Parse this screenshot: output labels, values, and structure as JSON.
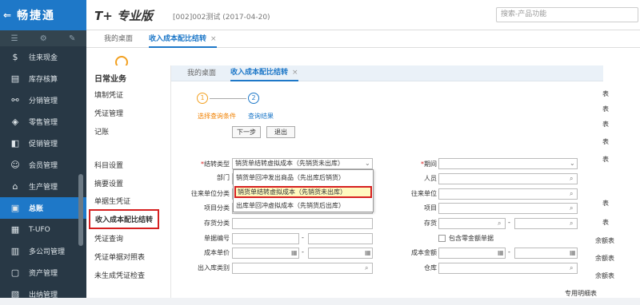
{
  "app": {
    "logo": "畅捷通",
    "brand": "T+ 专业版",
    "account": "[002]002测试  (2017-04-20)",
    "search_placeholder": "搜索-产品功能"
  },
  "sidebar": {
    "items": [
      {
        "label": "往来现金",
        "icon": "cash-icon"
      },
      {
        "label": "库存核算",
        "icon": "stock-icon"
      },
      {
        "label": "分销管理",
        "icon": "distribution-icon"
      },
      {
        "label": "零售管理",
        "icon": "retail-icon"
      },
      {
        "label": "促销管理",
        "icon": "promotion-icon"
      },
      {
        "label": "会员管理",
        "icon": "member-icon"
      },
      {
        "label": "生产管理",
        "icon": "production-icon"
      },
      {
        "label": "总账",
        "icon": "ledger-icon"
      },
      {
        "label": "T-UFO",
        "icon": "ufo-icon"
      },
      {
        "label": "多公司管理",
        "icon": "company-icon"
      },
      {
        "label": "资产管理",
        "icon": "asset-icon"
      },
      {
        "label": "出纳管理",
        "icon": "cashier-icon"
      }
    ]
  },
  "tabs": {
    "home": "我的桌面",
    "current": "收入成本配比结转"
  },
  "menu": {
    "title": "日常业务",
    "items": [
      "填制凭证",
      "凭证管理",
      "记账",
      "科目设置",
      "摘要设置",
      "单据生凭证",
      "收入成本配比结转",
      "凭证查询",
      "凭证单据对照表",
      "未生成凭证检查"
    ]
  },
  "wizard": {
    "step1_num": "1",
    "step2_num": "2",
    "step1_label": "选择查询条件",
    "step2_label": "查询结果",
    "next_button": "下一步",
    "exit_button": "退出"
  },
  "form": {
    "left_labels": [
      "结转类型",
      "部门",
      "往来单位分类",
      "项目分类",
      "存货分类",
      "单据编号",
      "成本单价",
      "出入库类别"
    ],
    "right_labels": [
      "期间",
      "人员",
      "往来单位",
      "项目",
      "存货",
      "包含零金额单据",
      "成本金额",
      "仓库"
    ],
    "transfer_type_value": "销货单结转虚拟成本（先销货未出库）",
    "dash": "-",
    "dropdown_options": [
      "销货单回冲发出商品（先出库后销货）",
      "销货单结转虚拟成本（先销货未出库）",
      "出库单回冲虚拟成本（先销货后出库）"
    ]
  },
  "right_edge": [
    "表",
    "表",
    "表",
    "表",
    "表",
    "表",
    "表",
    "余额表",
    "余额表",
    "余额表",
    "专用明细表"
  ]
}
